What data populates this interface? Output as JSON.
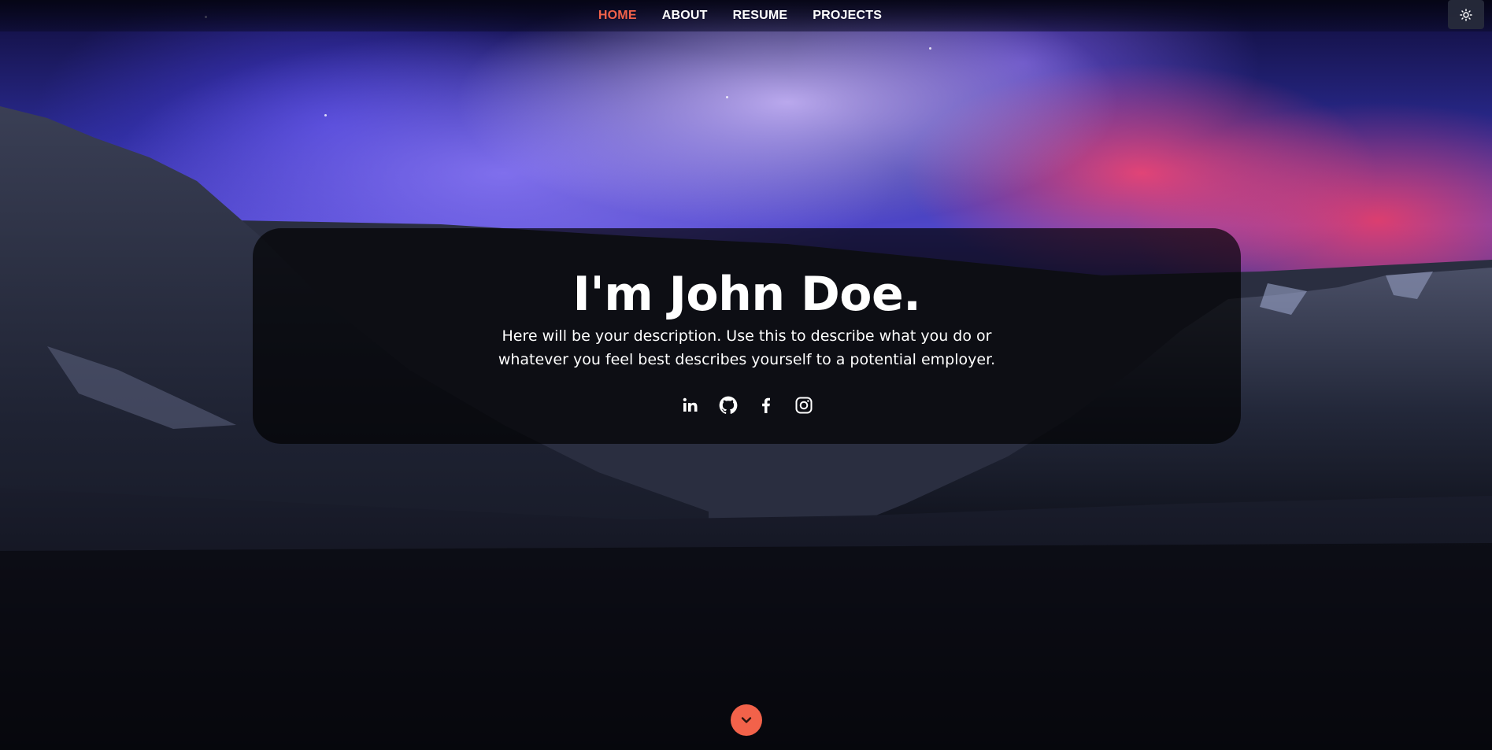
{
  "nav": {
    "items": [
      {
        "label": "HOME",
        "active": true
      },
      {
        "label": "ABOUT",
        "active": false
      },
      {
        "label": "RESUME",
        "active": false
      },
      {
        "label": "PROJECTS",
        "active": false
      }
    ],
    "theme_toggle_icon": "sun-icon"
  },
  "hero": {
    "title": "I'm John Doe.",
    "description": "Here will be your description. Use this to describe what you do or whatever you feel best describes yourself to a potential employer.",
    "social_icons": [
      "linkedin-icon",
      "github-icon",
      "facebook-icon",
      "instagram-icon"
    ]
  },
  "scroll_down_icon": "chevron-down-icon",
  "colors": {
    "accent": "#f2624a",
    "text": "#ffffff",
    "card_bg": "rgba(0,0,0,0.68)"
  }
}
